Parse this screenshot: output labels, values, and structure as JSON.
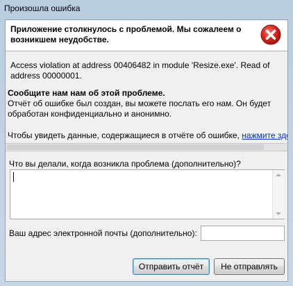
{
  "window": {
    "title": "Произошла ошибка"
  },
  "header": {
    "message": "Приложение столкнулось с проблемой. Мы сожалеем о возникшем неудобстве.",
    "icon": "error-icon",
    "icon_color": "#d8281f"
  },
  "details": {
    "text": "Access violation at address 00406482 in module 'Resize.exe'. Read of address 00000001."
  },
  "report": {
    "heading": "Сообщите нам нам об этой проблеме.",
    "body": "Отчёт об ошибке был создан, вы можете послать его нам. Он будет обработан конфиденциально и анонимно.",
    "data_prefix": "Чтобы увидеть данные, содержащиеся в отчёте об ошибке,",
    "data_link": "нажмите здесь"
  },
  "form": {
    "what_label": "Что вы делали, когда возникла проблема (дополнительно)?",
    "what_value": "",
    "email_label": "Ваш адрес электронной почты (дополнительно):",
    "email_value": ""
  },
  "buttons": {
    "send": "Отправить отчёт",
    "dont_send": "Не отправлять"
  }
}
